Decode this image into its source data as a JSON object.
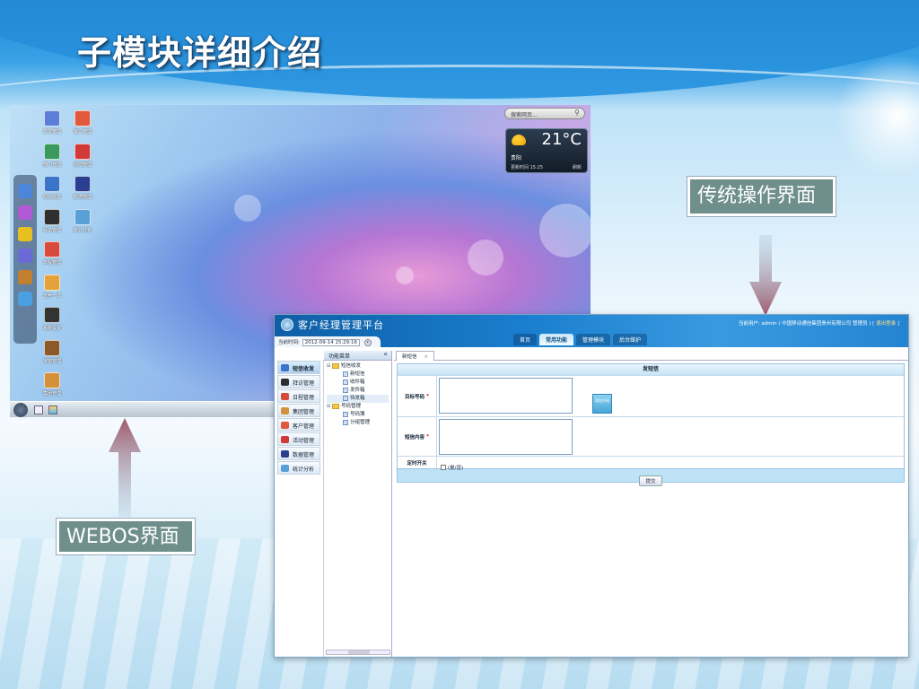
{
  "slide": {
    "title": "子模块详细介绍",
    "webos_label": "WEBOS界面",
    "classic_label": "传统操作界面"
  },
  "webos": {
    "desktop_icons": [
      {
        "label": "权限管理",
        "icon": "card-icon",
        "color": "#5b7fd6"
      },
      {
        "label": "客户管理",
        "icon": "person-card-icon",
        "color": "#e0593a"
      },
      {
        "label": "部门管理",
        "icon": "people-icon",
        "color": "#3a9a5d"
      },
      {
        "label": "活动管理",
        "icon": "flag-icon",
        "color": "#d23a3a"
      },
      {
        "label": "短信收发",
        "icon": "message-icon",
        "color": "#3b74c9"
      },
      {
        "label": "数据管理",
        "icon": "book-icon",
        "color": "#2a3f8f"
      },
      {
        "label": "拜访管理",
        "icon": "checkbox-icon",
        "color": "#2f2f2f"
      },
      {
        "label": "统计分析",
        "icon": "chart-icon",
        "color": "#5aa0d8"
      },
      {
        "label": "日程管理",
        "icon": "calendar-icon",
        "color": "#d84a3a"
      },
      {
        "label": "五色一体",
        "icon": "palette-icon",
        "color": "#e3a33a"
      },
      {
        "label": "系统设置",
        "icon": "camera-icon",
        "color": "#333333"
      },
      {
        "label": "字典管理",
        "icon": "books-icon",
        "color": "#8b5a2b"
      },
      {
        "label": "集团管理",
        "icon": "building-icon",
        "color": "#d5903a"
      }
    ],
    "dock_icons": [
      {
        "icon": "globe-icon",
        "color": "#4b86d8"
      },
      {
        "icon": "star-icon",
        "color": "#b05ad6"
      },
      {
        "icon": "sun-icon",
        "color": "#e6c020"
      },
      {
        "icon": "grid-icon",
        "color": "#6a6ad6"
      },
      {
        "icon": "id-icon",
        "color": "#c08030"
      },
      {
        "icon": "screen-icon",
        "color": "#4aa0e0"
      }
    ],
    "search_placeholder": "搜索网页...",
    "weather": {
      "temp": "21°C",
      "city": "贵阳",
      "updated": "更新时间 15:25",
      "refresh": "刷新"
    }
  },
  "app": {
    "title": "客户经理管理平台",
    "user_info": "当前用户: admin ( 中国移动通信集团贵州有限公司 管理员 ) [",
    "logout": "退出登录",
    "user_info_end": "]",
    "nav_tabs": [
      {
        "label": "首页",
        "active": false
      },
      {
        "label": "常用功能",
        "active": true
      },
      {
        "label": "管理模块",
        "active": false
      },
      {
        "label": "后台维护",
        "active": false
      }
    ],
    "time_label": "当前时间:",
    "time_value": "2012-09-14 15:29:16",
    "left_items": [
      {
        "label": "短信收发",
        "color": "#3b74c9",
        "active": true
      },
      {
        "label": "拜访管理",
        "color": "#2f2f2f",
        "active": false
      },
      {
        "label": "日程管理",
        "color": "#d84a3a",
        "active": false
      },
      {
        "label": "集团管理",
        "color": "#d5903a",
        "active": false
      },
      {
        "label": "客户管理",
        "color": "#e0593a",
        "active": false
      },
      {
        "label": "活动管理",
        "color": "#d23a3a",
        "active": false
      },
      {
        "label": "数据管理",
        "color": "#2a3f8f",
        "active": false
      },
      {
        "label": "统计分析",
        "color": "#5aa0d8",
        "active": false
      }
    ],
    "tree": {
      "header": "功能菜单",
      "collapse": "«",
      "nodes": [
        {
          "label": "短信收发",
          "type": "folder",
          "level": 0
        },
        {
          "label": "新短信",
          "type": "doc",
          "level": 1
        },
        {
          "label": "收件箱",
          "type": "doc",
          "level": 1
        },
        {
          "label": "发件箱",
          "type": "doc",
          "level": 1
        },
        {
          "label": "待发箱",
          "type": "doc",
          "level": 1,
          "selected": true
        },
        {
          "label": "号码管理",
          "type": "folder",
          "level": 0
        },
        {
          "label": "号码簿",
          "type": "doc",
          "level": 1
        },
        {
          "label": "分组管理",
          "type": "doc",
          "level": 1
        }
      ]
    },
    "work_tab": "新短信",
    "form": {
      "title": "发短信",
      "target_label": "目标号码",
      "content_label": "短信内容",
      "schedule_label": "定时开关",
      "schedule_option": "(是/否)",
      "pick_button": "添加号码",
      "submit": "提交"
    }
  }
}
